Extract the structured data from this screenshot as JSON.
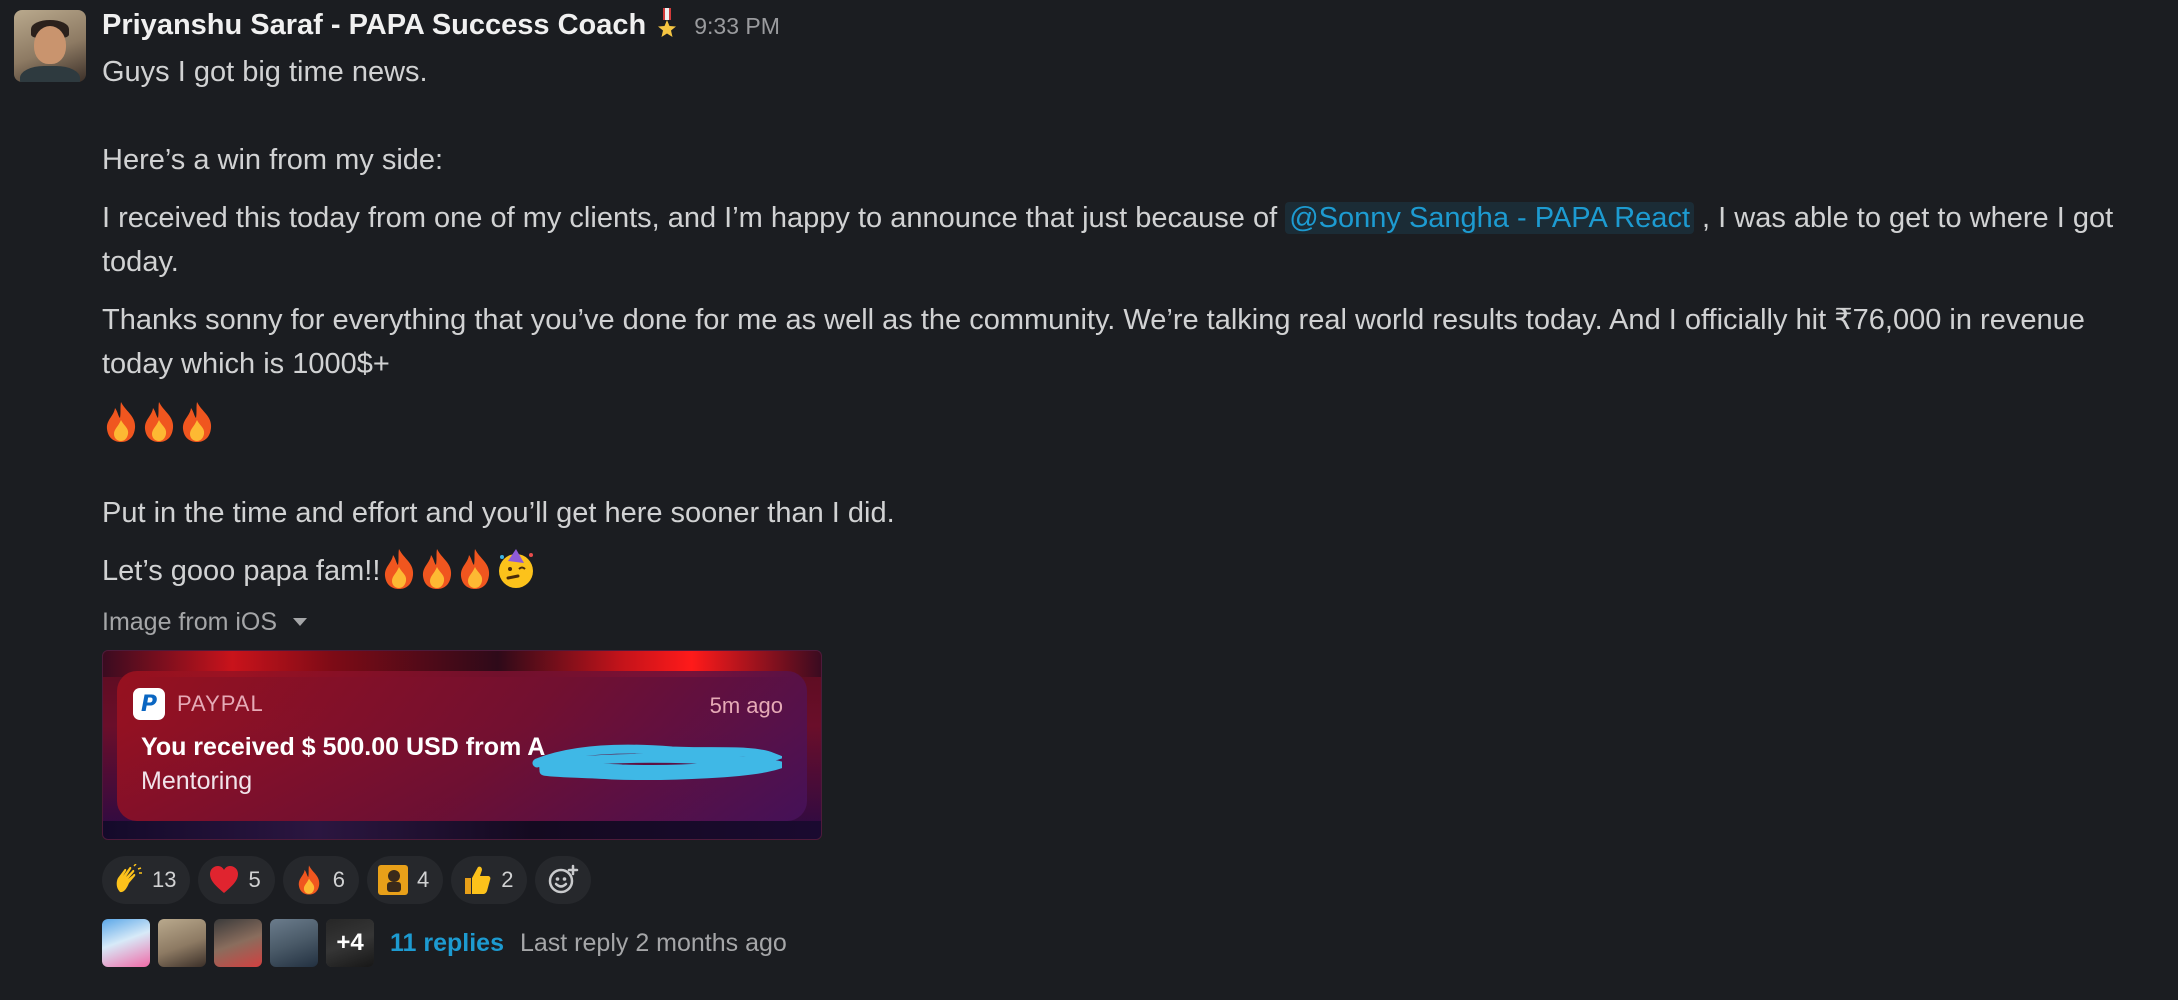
{
  "message": {
    "author": "Priyanshu Saraf - PAPA Success Coach",
    "status_icon": "medal-icon",
    "timestamp": "9:33 PM",
    "lines": {
      "l1": "Guys I got big time news.",
      "l2": "Here’s a win from my side:",
      "l3_pre": "I received this today from one of my clients, and I’m happy to announce that just because of ",
      "mention": "@Sonny Sangha - PAPA React",
      "l3_post": " , I was able to get to where I got today.",
      "l4": "Thanks sonny for everything that you’ve done for me as well as the community. We’re talking real world results today. And I officially hit ₹76,000 in revenue today which is 1000$+",
      "l5": "Put in the time and effort and you’ll get here sooner than I did.",
      "l6": "Let’s gooo papa fam!!"
    },
    "emoji": [
      "fire",
      "fire",
      "fire"
    ],
    "closing_emoji": [
      "fire",
      "fire",
      "fire",
      "partying-face"
    ]
  },
  "attachment": {
    "label": "Image from iOS",
    "notification": {
      "app": "PAYPAL",
      "ago": "5m ago",
      "title": "You received $ 500.00 USD from A",
      "subtitle": "Mentoring"
    }
  },
  "reactions": [
    {
      "icon": "clapping-hands-icon",
      "count": "13"
    },
    {
      "icon": "red-heart-icon",
      "count": "5"
    },
    {
      "icon": "fire-icon",
      "count": "6"
    },
    {
      "icon": "custom-emoji-icon",
      "count": "4"
    },
    {
      "icon": "thumbs-up-icon",
      "count": "2"
    }
  ],
  "thread": {
    "more_count": "+4",
    "replies": "11 replies",
    "last_reply": "Last reply 2 months ago"
  },
  "colors": {
    "background": "#1b1d21",
    "text": "#d1d2d3",
    "link": "#1d9bd1",
    "muted": "#a5a6a8"
  }
}
